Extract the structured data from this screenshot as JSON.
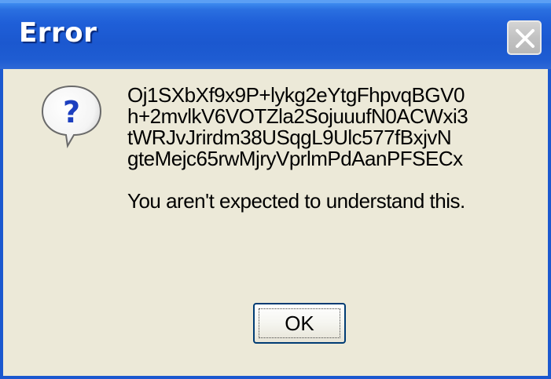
{
  "window": {
    "title": "Error",
    "close_icon": "close-icon"
  },
  "dialog": {
    "icon": "question-icon",
    "message_lines": [
      "Oj1SXbXf9x9P+lykg2eYtgFhpvqBGV0",
      "h+2mvlkV6VOTZla2SojuuufN0ACWxi3",
      "tWRJvJrirdm38USqgL9Ulc577fBxjvN",
      "gteMejc65rwMjryVprlmPdAanPFSECx"
    ],
    "note": "You aren't expected to understand this.",
    "ok_label": "OK"
  },
  "colors": {
    "titlebar": "#1b58cf",
    "body": "#ece9d8",
    "close_button": "#c2c2c2"
  }
}
